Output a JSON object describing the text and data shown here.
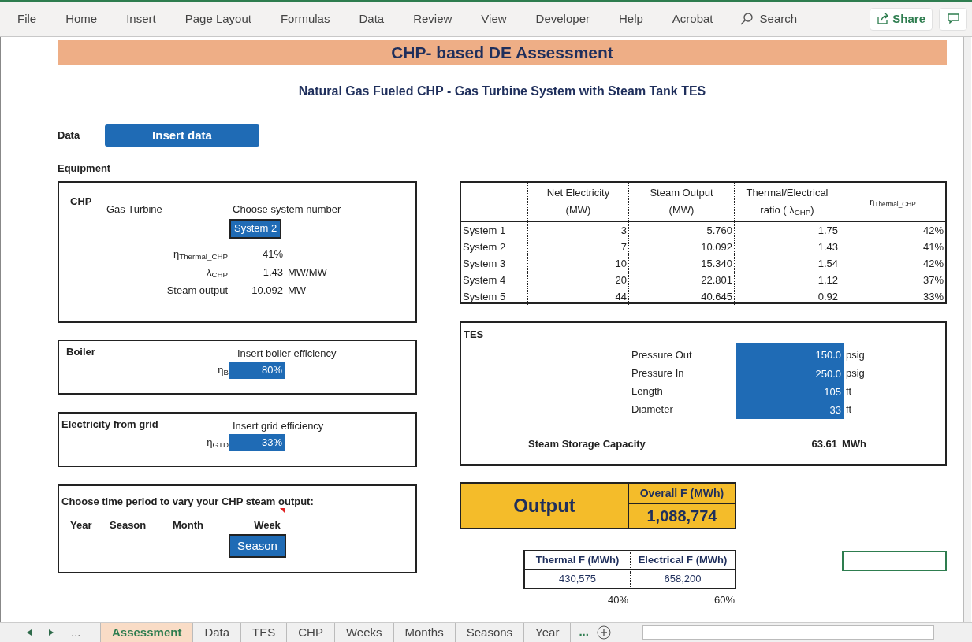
{
  "ribbon": {
    "tabs": [
      "File",
      "Home",
      "Insert",
      "Page Layout",
      "Formulas",
      "Data",
      "Review",
      "View",
      "Developer",
      "Help",
      "Acrobat"
    ],
    "search": "Search",
    "share": "Share"
  },
  "sheet": {
    "title": "CHP- based DE Assessment",
    "subtitle": "Natural Gas Fueled CHP - Gas Turbine System with Steam Tank TES",
    "data_label": "Data",
    "insert_button": "Insert data",
    "equipment_label": "Equipment"
  },
  "chp": {
    "label": "CHP",
    "type": "Gas Turbine",
    "prompt": "Choose system number",
    "system": "System 2",
    "params": [
      {
        "symbol": "η$_{Thermal_CHP}$",
        "value": "41%"
      },
      {
        "symbol": "λ$_{CHP}$",
        "value": "1.43",
        "unit": "MW/MW"
      },
      {
        "symbol": "Steam output",
        "value": "10.092",
        "unit": "MW"
      }
    ]
  },
  "boiler": {
    "label": "Boiler",
    "prompt": "Insert boiler efficiency",
    "symbol": "η$_{B}$",
    "value": "80%"
  },
  "grid": {
    "label": "Electricity from grid",
    "prompt": "Insert grid efficiency",
    "symbol": "η$_{GTD}$",
    "value": "33%"
  },
  "period": {
    "prompt": "Choose time period to vary your CHP steam output:",
    "options": [
      "Year",
      "Season",
      "Month",
      "Week"
    ],
    "value": "Season",
    "comment": true
  },
  "systems_table": {
    "columns": [
      "Net Electricity (MW)",
      "Steam Output (MW)",
      "Thermal/Electrical ratio ( λ$_{CHP}$)",
      "η$_{Thermal_CHP}$"
    ],
    "rows": [
      {
        "label": "System 1",
        "cells": [
          "3",
          "5.760",
          "1.75",
          "42%"
        ]
      },
      {
        "label": "System 2",
        "cells": [
          "7",
          "10.092",
          "1.43",
          "41%"
        ]
      },
      {
        "label": "System 3",
        "cells": [
          "10",
          "15.340",
          "1.54",
          "42%"
        ]
      },
      {
        "label": "System 4",
        "cells": [
          "20",
          "22.801",
          "1.12",
          "37%"
        ]
      },
      {
        "label": "System 5",
        "cells": [
          "44",
          "40.645",
          "0.92",
          "33%"
        ]
      }
    ]
  },
  "tes": {
    "label": "TES",
    "inputs": [
      {
        "name": "Pressure Out",
        "value": "150.0",
        "unit": "psig"
      },
      {
        "name": "Pressure In",
        "value": "250.0",
        "unit": "psig"
      },
      {
        "name": "Length",
        "value": "105",
        "unit": "ft"
      },
      {
        "name": "Diameter",
        "value": "33",
        "unit": "ft"
      }
    ],
    "capacity": {
      "label": "Steam Storage Capacity",
      "value": "63.61",
      "unit": "MWh"
    }
  },
  "output": {
    "label": "Output",
    "header": "Overall F (MWh)",
    "value": "1,088,774"
  },
  "split": {
    "columns": [
      "Thermal F (MWh)",
      "Electrical F (MWh)"
    ],
    "values": [
      "430,575",
      "658,200"
    ],
    "shares": [
      "40%",
      "60%"
    ]
  },
  "sheet_tabs": {
    "before": "...",
    "after": "...",
    "tabs": [
      {
        "label": "Assessment",
        "selected": true
      },
      {
        "label": "Data",
        "selected": false
      },
      {
        "label": "TES",
        "selected": false
      },
      {
        "label": "CHP",
        "selected": false
      },
      {
        "label": "Weeks",
        "selected": false
      },
      {
        "label": "Months",
        "selected": false
      },
      {
        "label": "Seasons",
        "selected": false
      },
      {
        "label": "Year",
        "selected": false
      }
    ]
  }
}
